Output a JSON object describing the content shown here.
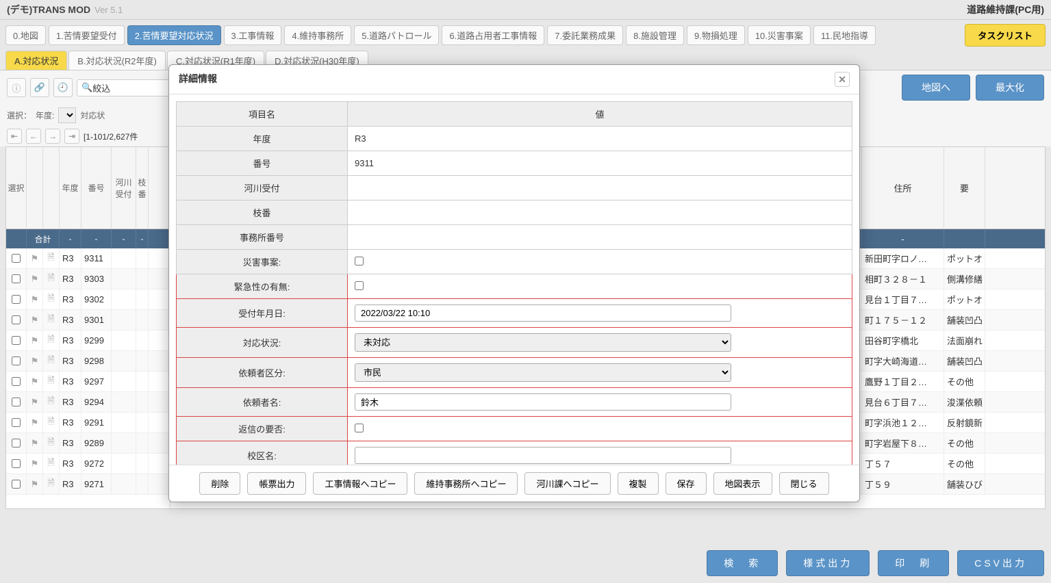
{
  "app": {
    "title": "(デモ)TRANS MOD",
    "version": "Ver 5.1",
    "department": "道路維持課(PC用)"
  },
  "main_tabs": [
    {
      "label": "0.地図"
    },
    {
      "label": "1.苦情要望受付"
    },
    {
      "label": "2.苦情要望対応状況",
      "active": true
    },
    {
      "label": "3.工事情報"
    },
    {
      "label": "4.維持事務所"
    },
    {
      "label": "5.道路パトロール"
    },
    {
      "label": "6.道路占用者工事情報"
    },
    {
      "label": "7.委託業務成果"
    },
    {
      "label": "8.施設管理"
    },
    {
      "label": "9.物損処理"
    },
    {
      "label": "10.災害事案"
    },
    {
      "label": "11.民地指導"
    }
  ],
  "tasklist_btn": "タスクリスト",
  "sub_tabs": [
    {
      "label": "A.対応状況",
      "active": true
    },
    {
      "label": "B.対応状況(R2年度)"
    },
    {
      "label": "C.対応状況(R1年度)"
    },
    {
      "label": "D.対応状況(H30年度)"
    }
  ],
  "toolbar": {
    "search_label": "絞込",
    "map_btn": "地図へ",
    "max_btn": "最大化"
  },
  "filter": {
    "label": "選択：",
    "year_label": "年度:",
    "status_label": "対応状"
  },
  "pager": {
    "range": "[1-101/2,627件"
  },
  "grid_headers": {
    "select": "選択",
    "year": "年度",
    "num": "番号",
    "river": "河川受付",
    "branch": "枝番",
    "addr": "住所",
    "req": "要"
  },
  "totals": {
    "label": "合計",
    "dash": "-"
  },
  "rows": [
    {
      "year": "R3",
      "num": "9311",
      "addr": "新田町字ロノ…",
      "req": "ポットオ"
    },
    {
      "year": "R3",
      "num": "9303",
      "addr": "相町３２８－１",
      "req": "側溝修繕"
    },
    {
      "year": "R3",
      "num": "9302",
      "addr": "見台１丁目７…",
      "req": "ポットオ"
    },
    {
      "year": "R3",
      "num": "9301",
      "addr": "町１７５－１２",
      "req": "舗装凹凸"
    },
    {
      "year": "R3",
      "num": "9299",
      "addr": "田谷町字橋北",
      "req": "法面崩れ"
    },
    {
      "year": "R3",
      "num": "9298",
      "addr": "町字大崎海道…",
      "req": "舗装凹凸"
    },
    {
      "year": "R3",
      "num": "9297",
      "addr": "鷹野１丁目２…",
      "req": "その他"
    },
    {
      "year": "R3",
      "num": "9294",
      "addr": "見台６丁目７…",
      "req": "浚渫依頼"
    },
    {
      "year": "R3",
      "num": "9291",
      "addr": "町字浜池１２…",
      "req": "反射鏡新"
    },
    {
      "year": "R3",
      "num": "9289",
      "addr": "町字岩屋下８…",
      "req": "その他"
    },
    {
      "year": "R3",
      "num": "9272",
      "addr": "丁５７",
      "req": "その他"
    },
    {
      "year": "R3",
      "num": "9271",
      "addr": "丁５９",
      "req": "舗装ひび"
    }
  ],
  "footer_buttons": {
    "search": "検　索",
    "format": "様式出力",
    "print": "印　刷",
    "csv": "CSV出力"
  },
  "modal": {
    "title": "詳細情報",
    "header_item": "項目名",
    "header_value": "値",
    "fields": [
      {
        "label": "年度",
        "value": "R3",
        "type": "text"
      },
      {
        "label": "番号",
        "value": "9311",
        "type": "text"
      },
      {
        "label": "河川受付",
        "value": "",
        "type": "text"
      },
      {
        "label": "枝番",
        "value": "",
        "type": "text"
      },
      {
        "label": "事務所番号",
        "value": "",
        "type": "text"
      },
      {
        "label": "災害事案:",
        "value": "",
        "type": "check"
      },
      {
        "label": "緊急性の有無:",
        "value": "",
        "type": "check",
        "req": true
      },
      {
        "label": "受付年月日:",
        "value": "2022/03/22 10:10",
        "type": "input",
        "req": true
      },
      {
        "label": "対応状況:",
        "value": "未対応",
        "type": "select",
        "req": true
      },
      {
        "label": "依頼者区分:",
        "value": "市民",
        "type": "select",
        "req": true
      },
      {
        "label": "依頼者名:",
        "value": "鈴木",
        "type": "input",
        "req": true
      },
      {
        "label": "返信の要否:",
        "value": "",
        "type": "check",
        "req": true
      },
      {
        "label": "校区名:",
        "value": "",
        "type": "input",
        "req": true
      }
    ],
    "buttons": [
      "削除",
      "帳票出力",
      "工事情報へコピー",
      "維持事務所へコピー",
      "河川課へコピー",
      "複製",
      "保存",
      "地図表示",
      "閉じる"
    ]
  }
}
